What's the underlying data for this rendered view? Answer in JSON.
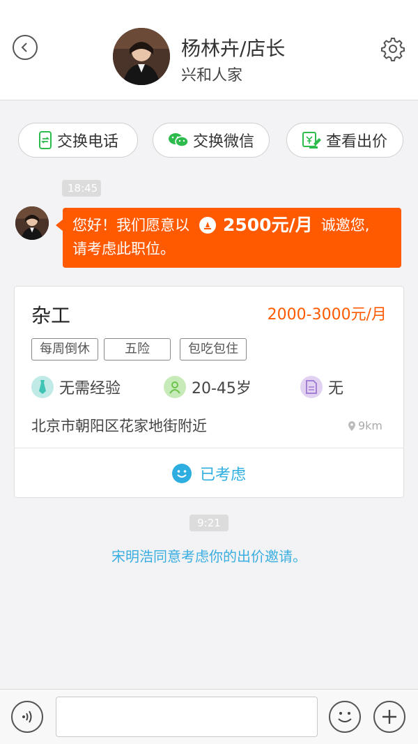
{
  "header": {
    "name": "杨林卉/店长",
    "subtitle": "兴和人家",
    "back_icon": "chevron-left-icon",
    "settings_icon": "gear-icon"
  },
  "actions": [
    {
      "label": "交换电话",
      "icon": "phone-swap-icon"
    },
    {
      "label": "交换微信",
      "icon": "wechat-icon"
    },
    {
      "label": "查看出价",
      "icon": "bid-view-icon"
    }
  ],
  "messages": {
    "time1": "18:45",
    "bubble": {
      "prefix": "您好！我们愿意以",
      "amount": "2500元/月",
      "suffix": "诚邀您,",
      "line2": "请考虑此职位。"
    },
    "time2": "9:21",
    "system": "宋明浩同意考虑你的出价邀请。"
  },
  "job": {
    "title": "杂工",
    "salary": "2000-3000元/月",
    "tags": [
      "每周倒休",
      "五险",
      "包吃包住"
    ],
    "requirements": {
      "experience": "无需经验",
      "age": "20-45岁",
      "education": "无"
    },
    "address": "北京市朝阳区花家地街附近",
    "distance": "9km",
    "status": "已考虑"
  },
  "input": {
    "placeholder": ""
  },
  "colors": {
    "accent": "#ff5a00",
    "link": "#2eaee0"
  }
}
